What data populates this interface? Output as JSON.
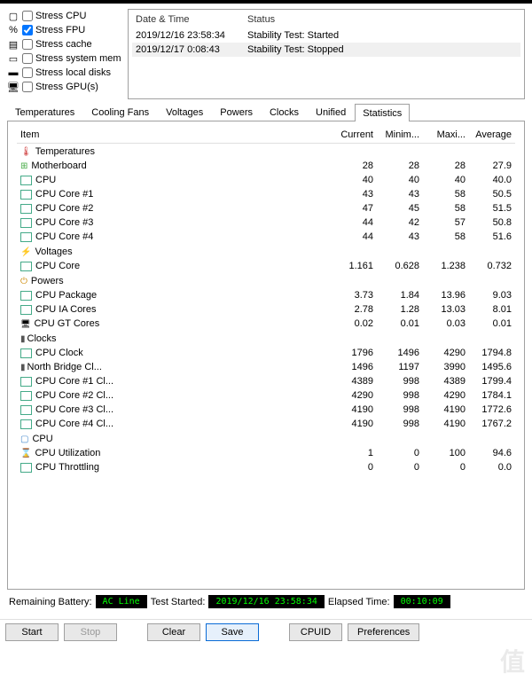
{
  "stress_options": [
    {
      "label": "Stress CPU",
      "checked": false,
      "icon": "cpu"
    },
    {
      "label": "Stress FPU",
      "checked": true,
      "icon": "fpu"
    },
    {
      "label": "Stress cache",
      "checked": false,
      "icon": "cache"
    },
    {
      "label": "Stress system mem",
      "checked": false,
      "icon": "mem"
    },
    {
      "label": "Stress local disks",
      "checked": false,
      "icon": "disk"
    },
    {
      "label": "Stress GPU(s)",
      "checked": false,
      "icon": "gpu"
    }
  ],
  "log": {
    "headers": {
      "datetime": "Date & Time",
      "status": "Status"
    },
    "rows": [
      {
        "dt": "2019/12/16 23:58:34",
        "status": "Stability Test: Started"
      },
      {
        "dt": "2019/12/17 0:08:43",
        "status": "Stability Test: Stopped"
      }
    ]
  },
  "tabs": [
    "Temperatures",
    "Cooling Fans",
    "Voltages",
    "Powers",
    "Clocks",
    "Unified",
    "Statistics"
  ],
  "active_tab": "Statistics",
  "table": {
    "headers": {
      "item": "Item",
      "cur": "Current",
      "min": "Minim...",
      "max": "Maxi...",
      "avg": "Average"
    },
    "sections": [
      {
        "name": "Temperatures",
        "icon": "therm-ico",
        "rows": [
          {
            "name": "Motherboard",
            "icon": "mb-ico",
            "cur": "28",
            "min": "28",
            "max": "28",
            "avg": "27.9"
          },
          {
            "name": "CPU",
            "icon": "sq-green",
            "cur": "40",
            "min": "40",
            "max": "40",
            "avg": "40.0"
          },
          {
            "name": "CPU Core #1",
            "icon": "sq-green",
            "cur": "43",
            "min": "43",
            "max": "58",
            "avg": "50.5"
          },
          {
            "name": "CPU Core #2",
            "icon": "sq-green",
            "cur": "47",
            "min": "45",
            "max": "58",
            "avg": "51.5"
          },
          {
            "name": "CPU Core #3",
            "icon": "sq-green",
            "cur": "44",
            "min": "42",
            "max": "57",
            "avg": "50.8"
          },
          {
            "name": "CPU Core #4",
            "icon": "sq-green",
            "cur": "44",
            "min": "43",
            "max": "58",
            "avg": "51.6"
          }
        ]
      },
      {
        "name": "Voltages",
        "icon": "volt-ico",
        "rows": [
          {
            "name": "CPU Core",
            "icon": "sq-green",
            "cur": "1.161",
            "min": "0.628",
            "max": "1.238",
            "avg": "0.732"
          }
        ]
      },
      {
        "name": "Powers",
        "icon": "power-ico",
        "rows": [
          {
            "name": "CPU Package",
            "icon": "sq-green",
            "cur": "3.73",
            "min": "1.84",
            "max": "13.96",
            "avg": "9.03"
          },
          {
            "name": "CPU IA Cores",
            "icon": "sq-green",
            "cur": "2.78",
            "min": "1.28",
            "max": "13.03",
            "avg": "8.01"
          },
          {
            "name": "CPU GT Cores",
            "icon": "gt-ico",
            "cur": "0.02",
            "min": "0.01",
            "max": "0.03",
            "avg": "0.01"
          }
        ]
      },
      {
        "name": "Clocks",
        "icon": "clock-ico",
        "rows": [
          {
            "name": "CPU Clock",
            "icon": "sq-green",
            "cur": "1796",
            "min": "1496",
            "max": "4290",
            "avg": "1794.8"
          },
          {
            "name": "North Bridge Cl...",
            "icon": "clock-ico",
            "cur": "1496",
            "min": "1197",
            "max": "3990",
            "avg": "1495.6"
          },
          {
            "name": "CPU Core #1 Cl...",
            "icon": "sq-green",
            "cur": "4389",
            "min": "998",
            "max": "4389",
            "avg": "1799.4"
          },
          {
            "name": "CPU Core #2 Cl...",
            "icon": "sq-green",
            "cur": "4290",
            "min": "998",
            "max": "4290",
            "avg": "1784.1"
          },
          {
            "name": "CPU Core #3 Cl...",
            "icon": "sq-green",
            "cur": "4190",
            "min": "998",
            "max": "4190",
            "avg": "1772.6"
          },
          {
            "name": "CPU Core #4 Cl...",
            "icon": "sq-green",
            "cur": "4190",
            "min": "998",
            "max": "4190",
            "avg": "1767.2"
          }
        ]
      },
      {
        "name": "CPU",
        "icon": "cpu-ico",
        "rows": [
          {
            "name": "CPU Utilization",
            "icon": "hour-ico",
            "cur": "1",
            "min": "0",
            "max": "100",
            "avg": "94.6"
          },
          {
            "name": "CPU Throttling",
            "icon": "sq-green",
            "cur": "0",
            "min": "0",
            "max": "0",
            "avg": "0.0"
          }
        ]
      }
    ]
  },
  "status_bar": {
    "battery_label": "Remaining Battery:",
    "battery_val": "AC Line",
    "started_label": "Test Started:",
    "started_val": "2019/12/16 23:58:34",
    "elapsed_label": "Elapsed Time:",
    "elapsed_val": "00:10:09"
  },
  "buttons": {
    "start": "Start",
    "stop": "Stop",
    "clear": "Clear",
    "save": "Save",
    "cpuid": "CPUID",
    "prefs": "Preferences"
  },
  "watermark": "值"
}
